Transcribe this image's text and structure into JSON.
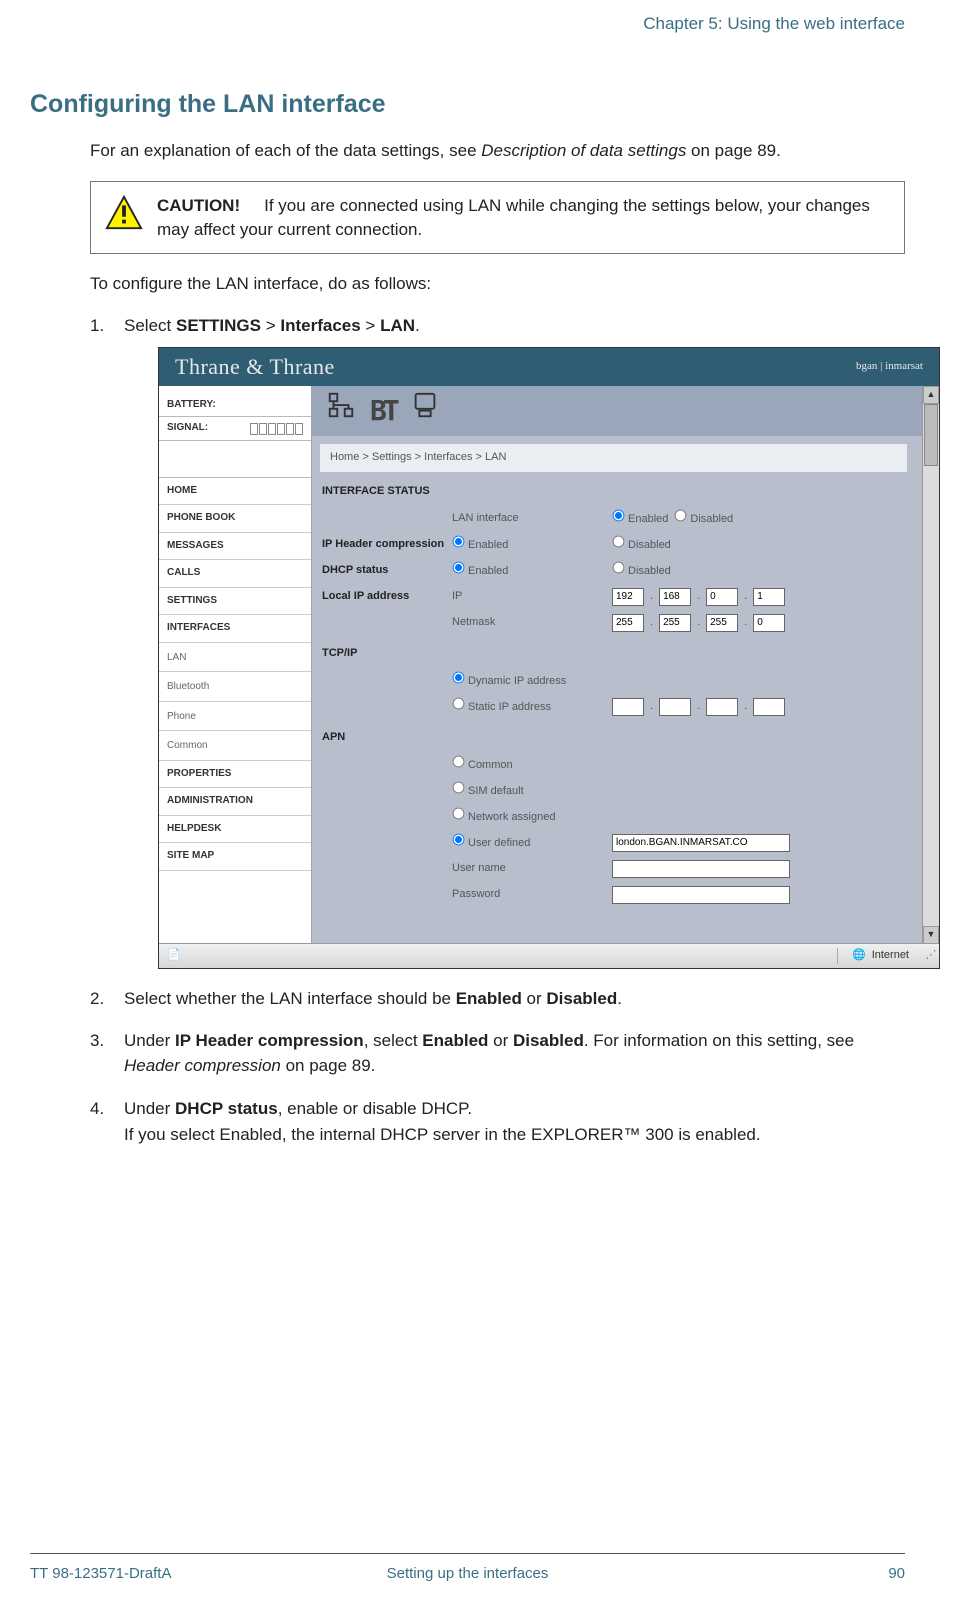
{
  "chapter": "Chapter 5: Using the web interface",
  "heading": "Configuring the LAN interface",
  "intro_pre": "For an explanation of each of the data settings, see ",
  "intro_em": "Description of data settings",
  "intro_post": " on page 89.",
  "caution_label": "CAUTION!",
  "caution_text": "If you are connected using LAN while changing the settings below, your changes may affect your current connection.",
  "lead": "To configure the LAN interface, do as follows:",
  "steps": {
    "s1_num": "1.",
    "s1_pre": "Select ",
    "s1_a": "SETTINGS",
    "s1_sep1": " > ",
    "s1_b": "Interfaces",
    "s1_sep2": " > ",
    "s1_c": "LAN",
    "s1_post": ".",
    "s2_num": "2.",
    "s2_pre": "Select whether the LAN interface should be ",
    "s2_a": "Enabled",
    "s2_mid": " or ",
    "s2_b": "Disabled",
    "s2_post": ".",
    "s3_num": "3.",
    "s3_pre": "Under ",
    "s3_a": "IP Header compression",
    "s3_mid1": ", select ",
    "s3_b": "Enabled",
    "s3_mid2": " or ",
    "s3_c": "Disabled",
    "s3_mid3": ". For information on this setting, see ",
    "s3_em": "Header compression",
    "s3_post": " on page 89.",
    "s4_num": "4.",
    "s4_pre": "Under ",
    "s4_a": "DHCP status",
    "s4_mid": ", enable or disable DHCP.",
    "s4_line2": "If you select Enabled, the internal DHCP server in the EXPLORER™ 300 is enabled."
  },
  "shot": {
    "brand": "Thrane & Thrane",
    "provider": "bgan | inmarsat",
    "battery_label": "BATTERY:",
    "signal_label": "SIGNAL:",
    "nav": {
      "home": "HOME",
      "phonebook": "PHONE BOOK",
      "messages": "MESSAGES",
      "calls": "CALLS",
      "settings": "SETTINGS",
      "interfaces": "INTERFACES",
      "lan": "LAN",
      "bluetooth": "Bluetooth",
      "phone": "Phone",
      "common": "Common",
      "properties": "PROPERTIES",
      "admin": "ADMINISTRATION",
      "helpdesk": "HELPDESK",
      "sitemap": "SITE MAP"
    },
    "crumb": "Home > Settings > Interfaces > LAN",
    "sections": {
      "status": "INTERFACE STATUS",
      "tcpip": "TCP/IP",
      "apn": "APN"
    },
    "labels": {
      "lan_if": "LAN interface",
      "ip_hdr": "IP Header compression",
      "dhcp": "DHCP status",
      "local_ip": "Local IP address",
      "ip": "IP",
      "netmask": "Netmask",
      "dyn": "Dynamic IP address",
      "static": "Static IP address",
      "apn_common": "Common",
      "apn_sim": "SIM default",
      "apn_net": "Network assigned",
      "apn_user": "User defined",
      "username": "User name",
      "password": "Password",
      "enabled": "Enabled",
      "disabled": "Disabled"
    },
    "values": {
      "ip1": "192",
      "ip2": "168",
      "ip3": "0",
      "ip4": "1",
      "nm1": "255",
      "nm2": "255",
      "nm3": "255",
      "nm4": "0",
      "apn_user_val": "london.BGAN.INMARSAT.CO"
    },
    "status_internet": "Internet"
  },
  "footer": {
    "left": "TT 98-123571-DraftA",
    "center": "Setting up the interfaces",
    "right": "90"
  }
}
